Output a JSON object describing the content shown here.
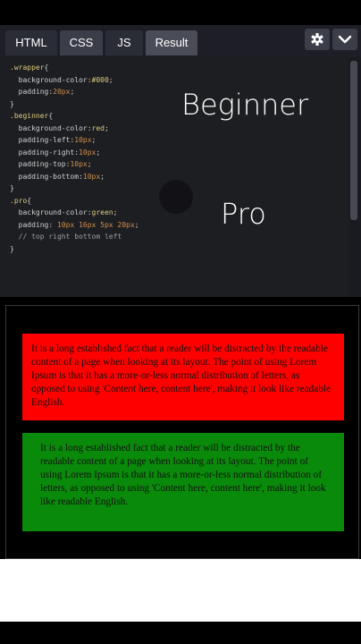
{
  "editor": {
    "tabs": [
      "HTML",
      "CSS",
      "JS",
      "Result"
    ],
    "settings_icon": "gear-icon",
    "collapse_icon": "chevron-down-icon"
  },
  "code_lines": [
    [
      {
        "t": ".wrapper",
        "c": "sel"
      },
      {
        "t": "{",
        "c": "punc"
      }
    ],
    [
      {
        "t": "  background-color:",
        "c": "prop"
      },
      {
        "t": "#000",
        "c": "val"
      },
      {
        "t": ";",
        "c": "punc"
      }
    ],
    [
      {
        "t": "  padding:",
        "c": "prop"
      },
      {
        "t": "20px",
        "c": "num"
      },
      {
        "t": ";",
        "c": "punc"
      }
    ],
    [
      {
        "t": "}",
        "c": "punc"
      }
    ],
    [
      {
        "t": ".beginner",
        "c": "sel"
      },
      {
        "t": "{",
        "c": "punc"
      }
    ],
    [
      {
        "t": "  background-color:",
        "c": "prop"
      },
      {
        "t": "red",
        "c": "val"
      },
      {
        "t": ";",
        "c": "punc"
      }
    ],
    [
      {
        "t": "  padding-left:",
        "c": "prop"
      },
      {
        "t": "10px",
        "c": "num"
      },
      {
        "t": ";",
        "c": "punc"
      }
    ],
    [
      {
        "t": "  padding-right:",
        "c": "prop"
      },
      {
        "t": "10px",
        "c": "num"
      },
      {
        "t": ";",
        "c": "punc"
      }
    ],
    [
      {
        "t": "  padding-top:",
        "c": "prop"
      },
      {
        "t": "10px",
        "c": "num"
      },
      {
        "t": ";",
        "c": "punc"
      }
    ],
    [
      {
        "t": "  padding-bottom:",
        "c": "prop"
      },
      {
        "t": "10px",
        "c": "num"
      },
      {
        "t": ";",
        "c": "punc"
      }
    ],
    [
      {
        "t": "}",
        "c": "punc"
      }
    ],
    [
      {
        "t": ".pro",
        "c": "sel"
      },
      {
        "t": "{",
        "c": "punc"
      }
    ],
    [
      {
        "t": "  background-color:",
        "c": "prop"
      },
      {
        "t": "green",
        "c": "val"
      },
      {
        "t": ";",
        "c": "punc"
      }
    ],
    [
      {
        "t": "  padding: ",
        "c": "prop"
      },
      {
        "t": "10px 16px 5px 20px",
        "c": "num"
      },
      {
        "t": ";",
        "c": "punc"
      }
    ],
    [
      {
        "t": "  // top right bottom left",
        "c": "cmt"
      }
    ],
    [
      {
        "t": "}",
        "c": "punc"
      }
    ]
  ],
  "overlay": {
    "beginner_label": "Beginner",
    "pro_label": "Pro"
  },
  "result": {
    "beginner_text": "It is a long established fact that a reader will be distracted by the readable content of a page when looking at its layout. The point of using Lorem Ipsum is that it has a more-or-less normal distribution of letters, as opposed to using 'Content here, content here', making it look like readable English.",
    "pro_text": "It is a long established fact that a reader will be distracted by the readable content of a page when looking at its layout. The point of using Lorem Ipsum is that it has a more-or-less normal distribution of letters, as opposed to using 'Content here, content here', making it look like readable English.",
    "beginner_color": "#ff0000",
    "pro_color": "#0a8a0a"
  }
}
